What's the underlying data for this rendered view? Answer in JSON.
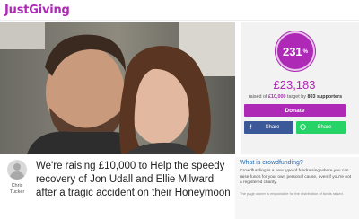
{
  "header": {
    "logo_text": "JustGiving"
  },
  "photo": {
    "alt": ""
  },
  "progress": {
    "percent": 231,
    "percent_text": "231",
    "percent_sign": "%"
  },
  "totals": {
    "amount": "£23,183",
    "raised_prefix": "raised of",
    "target": "£10,000",
    "target_suffix": "target by",
    "supporters": "803 supporters"
  },
  "actions": {
    "donate_label": "Donate",
    "facebook_share_label": "Share",
    "whatsapp_share_label": "Share"
  },
  "author": {
    "line1": "Chris",
    "line2": "Tucker"
  },
  "page_title": "We're raising £10,000 to Help the speedy recovery of Jon Udall and Ellie Milward after a tragic accident on their Honeymoon",
  "crowdfunding": {
    "heading": "What is crowdfunding?",
    "body": "Crowdfunding is a new type of fundraising where you can raise funds for your own personal cause, even if you're not a registered charity.",
    "note": "The page owner is responsible for the distribution of funds raised."
  },
  "colors": {
    "brand": "#ad29b6",
    "facebook": "#3b5998",
    "whatsapp": "#25d366",
    "link": "#2a6fb0"
  },
  "icons": {
    "facebook": "facebook-icon",
    "whatsapp": "whatsapp-icon"
  }
}
